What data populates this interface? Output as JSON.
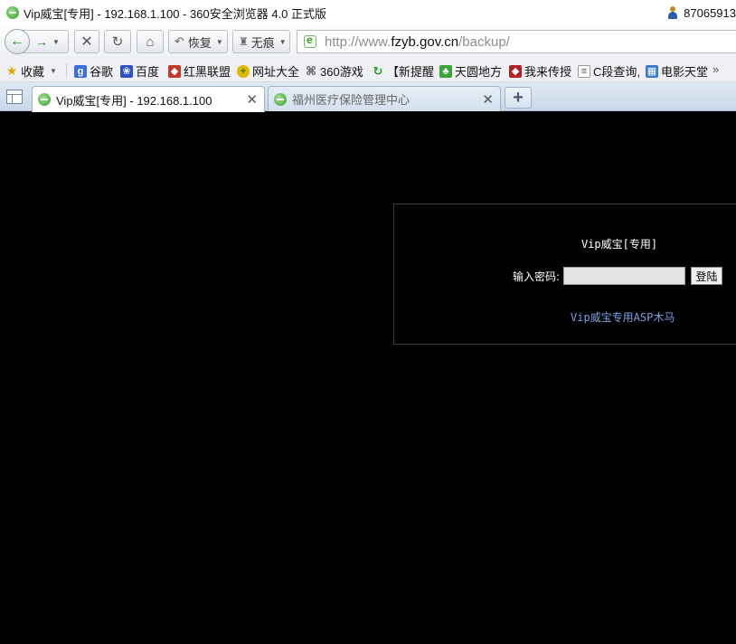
{
  "window": {
    "title": "Vip威宝[专用] - 192.168.1.100 - 360安全浏览器 4.0 正式版",
    "account": "87065913"
  },
  "navbar": {
    "restore_label": "恢复",
    "incognito_label": "无痕",
    "url_prefix": "http://www.",
    "url_host": "fzyb.gov.cn",
    "url_path": "/backup/"
  },
  "bookmarks": {
    "favorites_label": "收藏",
    "items": [
      {
        "label": "谷歌",
        "icon": "google-icon",
        "color": "#3b6fd8"
      },
      {
        "label": "百度",
        "icon": "baidu-paw-icon",
        "color": "#2b52c6"
      },
      {
        "label": "红黑联盟",
        "icon": "shield-icon",
        "color": "#c0392b"
      },
      {
        "label": "网址大全",
        "icon": "globe-icon",
        "color": "#e0b800"
      },
      {
        "label": "360游戏",
        "icon": "gamepad-icon",
        "color": "#555555"
      },
      {
        "label": "【新提醒",
        "icon": "refresh-icon",
        "color": "#2e9a2a"
      },
      {
        "label": "天圆地方",
        "icon": "tree-icon",
        "color": "#39a53a"
      },
      {
        "label": "我来传授",
        "icon": "shield-icon",
        "color": "#b22222"
      },
      {
        "label": "C段查询,",
        "icon": "page-icon",
        "color": "#ffffff"
      },
      {
        "label": "电影天堂",
        "icon": "film-icon",
        "color": "#3b7ac9"
      }
    ]
  },
  "tabs": [
    {
      "label": "Vip威宝[专用] - 192.168.1.100",
      "active": true
    },
    {
      "label": "福州医疗保险管理中心",
      "active": false
    }
  ],
  "page": {
    "title": "Vip威宝[专用]",
    "password_label": "输入密码:",
    "login_button": "登陆",
    "footer_link": "Vip威宝专用ASP木马"
  }
}
